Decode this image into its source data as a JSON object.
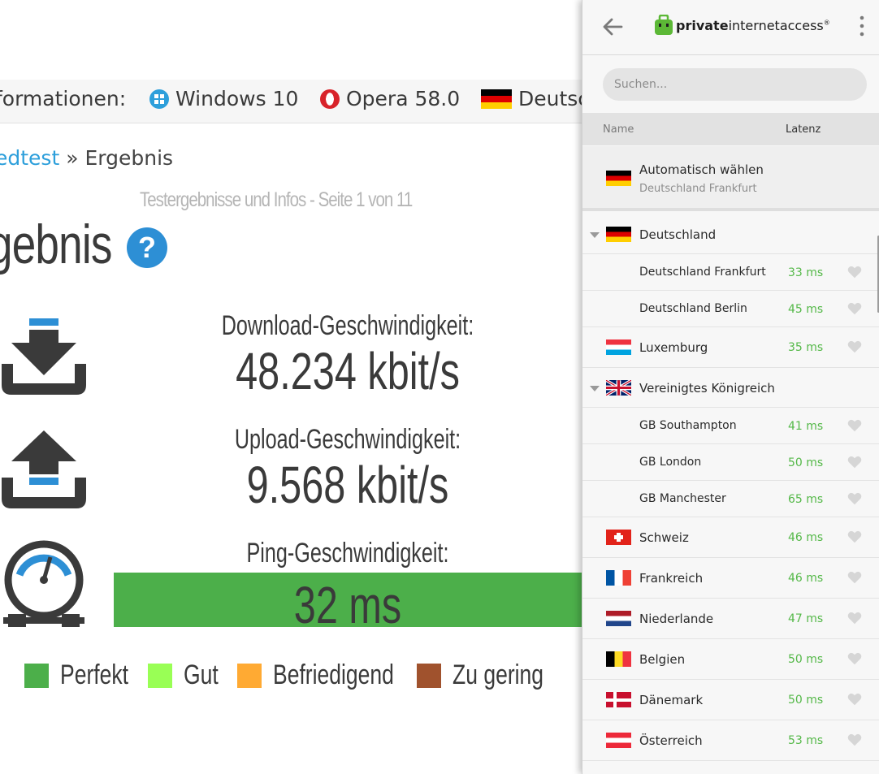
{
  "background_page": {
    "infobar": {
      "label": "formationen:",
      "os": "Windows 10",
      "browser": "Opera 58.0",
      "country": "Deutsc"
    },
    "breadcrumb": {
      "link": "edtest",
      "separator": "»",
      "current": "Ergebnis"
    },
    "subtitle": "Testergebnisse und Infos - Seite 1 von 11",
    "heading": "gebnis",
    "help_label": "?",
    "download": {
      "label": "Download-Geschwindigkeit:",
      "value": "48.234 kbit/s"
    },
    "upload": {
      "label": "Upload-Geschwindigkeit:",
      "value": "9.568 kbit/s"
    },
    "ping": {
      "label": "Ping-Geschwindigkeit:",
      "value": "32 ms"
    },
    "legend": [
      {
        "label": "Perfekt",
        "color": "#4caf4a"
      },
      {
        "label": "Gut",
        "color": "#99ff55"
      },
      {
        "label": "Befriedigend",
        "color": "#ffaa33"
      },
      {
        "label": "Zu gering",
        "color": "#a0522d"
      }
    ]
  },
  "pia": {
    "logo": {
      "bold": "private",
      "regular": "internetaccess",
      "mark": "®"
    },
    "search_placeholder": "Suchen...",
    "columns": {
      "name": "Name",
      "latency": "Latenz"
    },
    "auto": {
      "title": "Automatisch wählen",
      "subtitle": "Deutschland Frankfurt"
    },
    "regions": [
      {
        "type": "group",
        "name": "Deutschland",
        "flag": "de"
      },
      {
        "type": "sub",
        "name": "Deutschland Frankfurt",
        "latency": "33 ms"
      },
      {
        "type": "sub",
        "name": "Deutschland Berlin",
        "latency": "45 ms"
      },
      {
        "type": "country",
        "name": "Luxemburg",
        "flag": "lu",
        "latency": "35 ms"
      },
      {
        "type": "group",
        "name": "Vereinigtes Königreich",
        "flag": "gb"
      },
      {
        "type": "sub",
        "name": "GB Southampton",
        "latency": "41 ms"
      },
      {
        "type": "sub",
        "name": "GB London",
        "latency": "50 ms"
      },
      {
        "type": "sub",
        "name": "GB Manchester",
        "latency": "65 ms"
      },
      {
        "type": "country",
        "name": "Schweiz",
        "flag": "ch",
        "latency": "46 ms"
      },
      {
        "type": "country",
        "name": "Frankreich",
        "flag": "fr",
        "latency": "46 ms"
      },
      {
        "type": "country",
        "name": "Niederlande",
        "flag": "nl",
        "latency": "47 ms"
      },
      {
        "type": "country",
        "name": "Belgien",
        "flag": "be",
        "latency": "50 ms"
      },
      {
        "type": "country",
        "name": "Dänemark",
        "flag": "dk",
        "latency": "50 ms"
      },
      {
        "type": "country",
        "name": "Österreich",
        "flag": "at",
        "latency": "53 ms"
      }
    ]
  }
}
